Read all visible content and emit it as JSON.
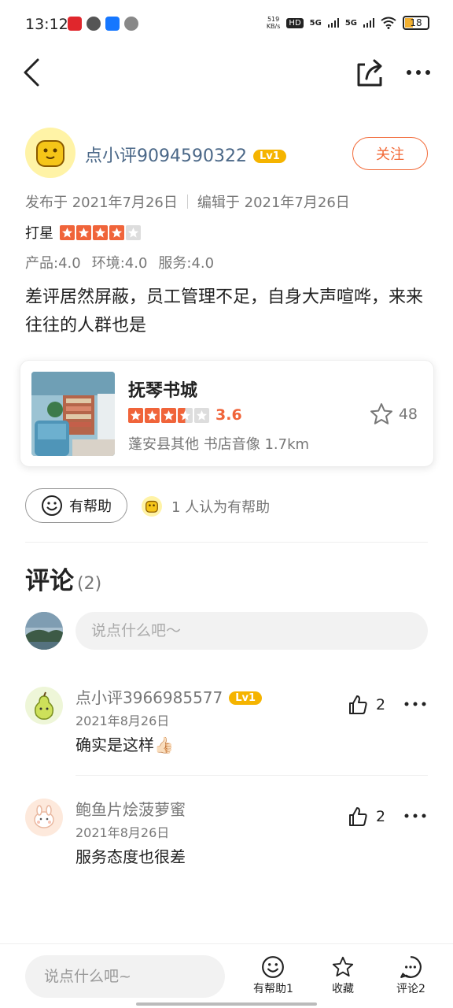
{
  "status_bar": {
    "time": "13:12",
    "net_speed": "519\nKB/s",
    "hd": "HD",
    "signal1": "5G",
    "signal2": "5G",
    "battery": "18"
  },
  "author": {
    "name": "点小评9094590322",
    "level": "Lv1",
    "follow_label": "关注"
  },
  "review": {
    "published": "发布于 2021年7月26日",
    "edited": "编辑于 2021年7月26日",
    "rating_label": "打星",
    "rating": 4,
    "scores": [
      "产品:4.0",
      "环境:4.0",
      "服务:4.0"
    ],
    "text": "差评居然屏蔽，员工管理不足，自身大声喧哗，来来往往的人群也是"
  },
  "shop": {
    "name": "抚琴书城",
    "rating": 3.5,
    "score_text": "3.6",
    "meta": "蓬安县其他 书店音像  1.7km",
    "favorites": "48"
  },
  "helpful": {
    "button_label": "有帮助",
    "info": "1 人认为有帮助"
  },
  "comments": {
    "title": "评论",
    "count": "(2)",
    "input_placeholder": "说点什么吧～",
    "items": [
      {
        "name": "点小评3966985577",
        "level": "Lv1",
        "date": "2021年8月26日",
        "text": "确实是这样👍🏻",
        "likes": "2"
      },
      {
        "name": "鲍鱼片烩菠萝蜜",
        "level": "",
        "date": "2021年8月26日",
        "text": "服务态度也很差",
        "likes": "2"
      }
    ]
  },
  "bottom_bar": {
    "input_placeholder": "说点什么吧~",
    "helpful_label": "有帮助1",
    "collect_label": "收藏",
    "comment_label": "评论2"
  },
  "colors": {
    "accent": "#f0643a",
    "level_badge": "#f5b400",
    "author_name": "#4a6787"
  }
}
